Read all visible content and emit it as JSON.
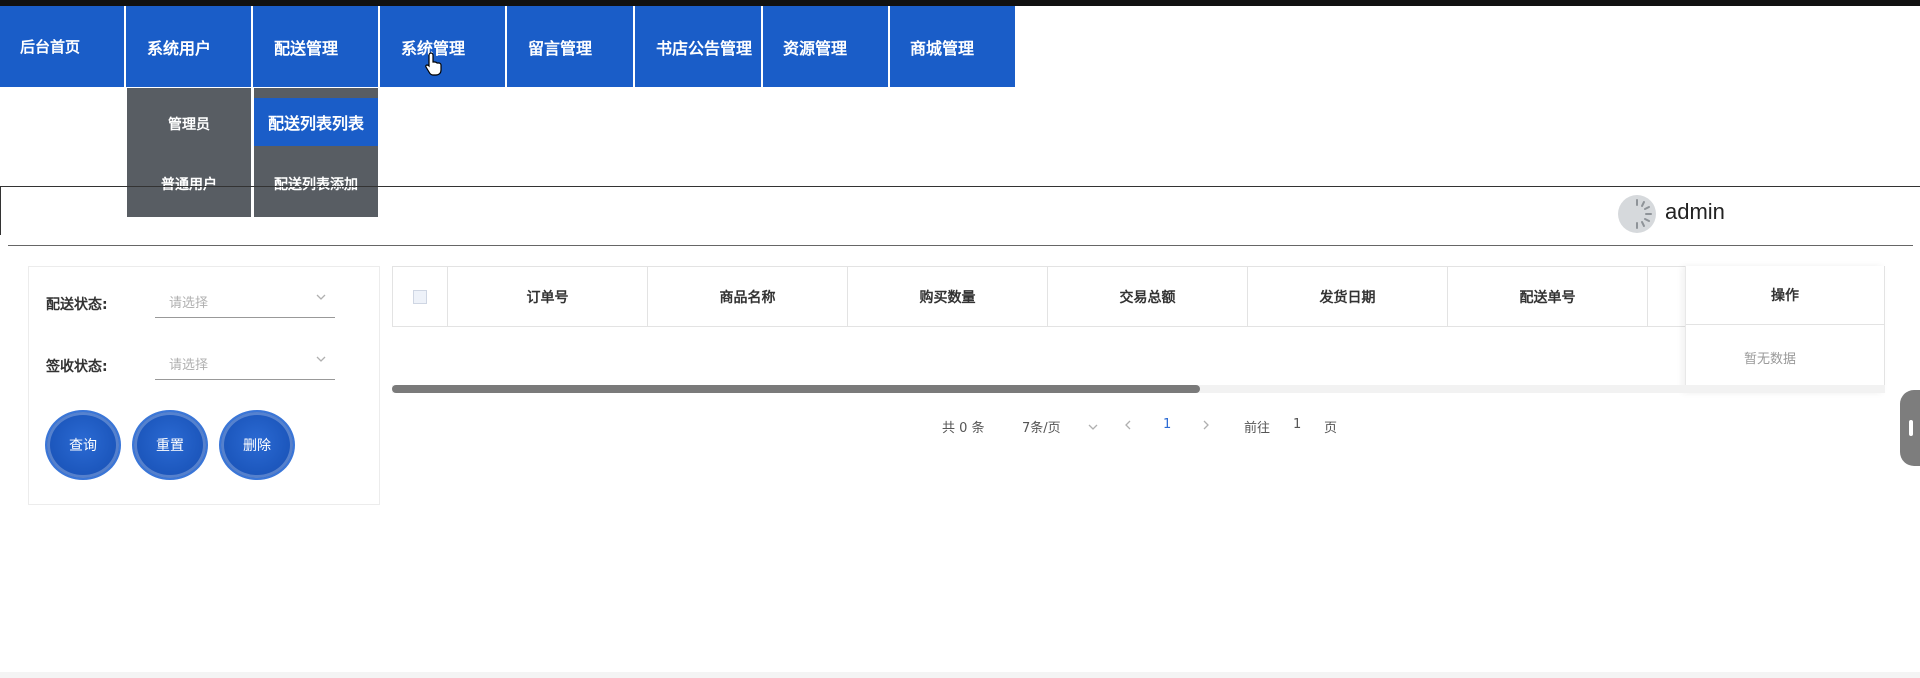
{
  "nav": {
    "items": [
      {
        "label": "后台首页"
      },
      {
        "label": "系统用户"
      },
      {
        "label": "配送管理"
      },
      {
        "label": "系统管理"
      },
      {
        "label": "留言管理"
      },
      {
        "label": "书店公告管理"
      },
      {
        "label": "资源管理"
      },
      {
        "label": "商城管理"
      }
    ],
    "submenu_users": [
      "管理员",
      "普通用户"
    ],
    "submenu_delivery": [
      "配送列表列表",
      "配送列表添加"
    ]
  },
  "header": {
    "username": "admin"
  },
  "search": {
    "delivery_status_label": "配送状态:",
    "receipt_status_label": "签收状态:",
    "placeholder": "请选择",
    "query_button": "查询",
    "reset_button": "重置",
    "delete_button": "删除"
  },
  "table": {
    "columns": [
      "订单号",
      "商品名称",
      "购买数量",
      "交易总额",
      "发货日期",
      "配送单号"
    ],
    "action_column": "操作",
    "empty_text": "暂无数据",
    "rows": []
  },
  "pagination": {
    "total": "共 0 条",
    "page_size": "7条/页",
    "current_page": "1",
    "goto_label": "前往",
    "goto_value": "1",
    "page_suffix": "页"
  },
  "colors": {
    "primary": "#1a5dc8",
    "submenu_bg": "#585d63"
  }
}
